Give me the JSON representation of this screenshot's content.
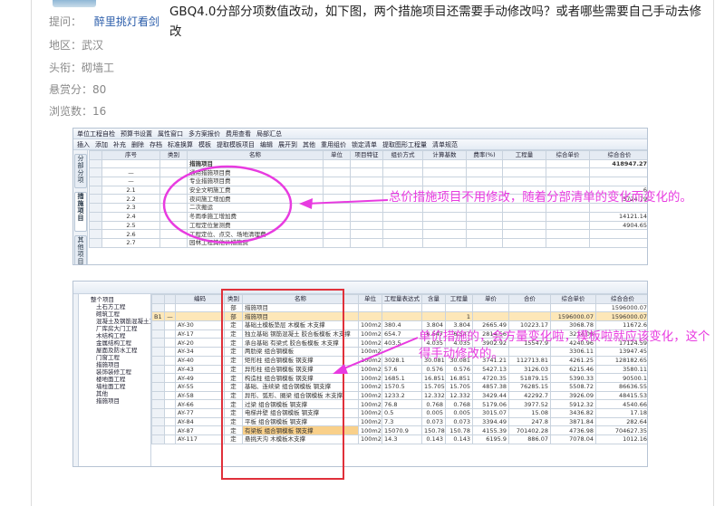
{
  "question": {
    "asker_label": "提问：",
    "asker_name": "醉里挑灯看剑",
    "region_label": "地区：",
    "region_value": "武汉",
    "title_label": "头衔：",
    "title_value": "砌墙工",
    "bounty_label": "悬赏分：",
    "bounty_value": "80",
    "views_label": "浏览数：",
    "views_value": "16",
    "text": "GBQ4.0分部分项数值改动，如下图，两个措施项目还需要手动修改吗？或者哪些需要自己手动去修改"
  },
  "shot1": {
    "toolbar1": [
      "单位工程自检",
      "预算书设置",
      "属性窗口",
      "多方案报价",
      "费用查看",
      "局部汇总"
    ],
    "toolbar2": [
      "插入",
      "添加",
      "补充",
      "删除",
      "存档",
      "标准换算",
      "模板",
      "提取模板项目",
      "编辑",
      "展开到",
      "其他",
      "重用组价",
      "锁定清单",
      "提取图形工程量",
      "清单规范"
    ],
    "side_tabs": [
      "分部分项",
      "措施项目",
      "其他项目"
    ],
    "headers": [
      "",
      "序号",
      "类别",
      "名称",
      "单位",
      "项目特征",
      "组价方式",
      "计算基数",
      "费率(%)",
      "工程量",
      "综合单价",
      "综合合价"
    ],
    "rows": [
      {
        "rh": "",
        "seq": "",
        "cat": "",
        "name": "措施项目",
        "total": "418947.27"
      },
      {
        "rh": "",
        "seq": "—",
        "cat": "",
        "name": "通用措施项目费",
        "total": ""
      },
      {
        "rh": "",
        "seq": "—",
        "cat": "",
        "name": "专业措施项目费",
        "total": ""
      },
      {
        "rh": "",
        "seq": "2.1",
        "cat": "",
        "name": "安全文明施工费",
        "total": "6"
      },
      {
        "rh": "",
        "seq": "2.2",
        "cat": "",
        "name": "夜间施工增加费",
        "total": "5724.79"
      },
      {
        "rh": "",
        "seq": "2.3",
        "cat": "",
        "name": "二次搬运",
        "total": ""
      },
      {
        "rh": "",
        "seq": "2.4",
        "cat": "",
        "name": "冬雨季施工增加费",
        "total": "14121.14"
      },
      {
        "rh": "",
        "seq": "2.5",
        "cat": "",
        "name": "工程定位复测费",
        "total": "4904.65"
      },
      {
        "rh": "",
        "seq": "2.6",
        "cat": "",
        "name": "工程定位、点交、场地清理费",
        "total": ""
      },
      {
        "rh": "",
        "seq": "2.7",
        "cat": "",
        "name": "园林工程其他价措施费",
        "total": ""
      }
    ]
  },
  "shot2": {
    "tree": [
      "整个项目",
      "土石方工程",
      "砌筑工程",
      "混凝土及钢筋混凝土工程",
      "厂库房大门工程",
      "木结构工程",
      "金属结构工程",
      "屋面及防水工程",
      "门窗工程",
      "措施项目",
      "装饰装修工程",
      "楼地面工程",
      "墙柱面工程",
      "其他",
      "措施项目"
    ],
    "headers": [
      "",
      "",
      "编码",
      "类别",
      "名称",
      "单位",
      "工程量表达式",
      "含量",
      "工程量",
      "单价",
      "合价",
      "综合单价",
      "综合合价"
    ],
    "rows": [
      {
        "a": "",
        "b": "",
        "code": "",
        "cat": "部",
        "name": "措施项目",
        "unit": "",
        "expr": "",
        "qty": "",
        "amt": "",
        "price": "",
        "sum": "",
        "uprice": "",
        "total": "1596000.07",
        "hl": false
      },
      {
        "a": "B1",
        "b": "—",
        "code": "",
        "cat": "部",
        "name": "措施项目",
        "unit": "",
        "expr": "",
        "qty": "",
        "amt": "1",
        "price": "",
        "sum": "",
        "uprice": "1596000.07",
        "total": "1596000.07",
        "hl": true
      },
      {
        "a": "",
        "b": "",
        "code": "AY-30",
        "cat": "定",
        "name": "基础土模板垫层 木模板 木支撑",
        "unit": "100m2",
        "expr": "380.4",
        "qty": "3.804",
        "amt": "3.804",
        "price": "2665.49",
        "sum": "10223.17",
        "uprice": "3068.78",
        "total": "11672.6",
        "hl": false
      },
      {
        "a": "",
        "b": "",
        "code": "AY-17",
        "cat": "定",
        "name": "独立基础 钢筋混凝土 胶合板模板 木支撑",
        "unit": "100m2",
        "expr": "654.7",
        "qty": "6.547",
        "amt": "6.547",
        "price": "2814.56",
        "sum": "",
        "uprice": "3214.06",
        "total": "",
        "hl": false
      },
      {
        "a": "",
        "b": "",
        "code": "AY-20",
        "cat": "定",
        "name": "承台基础 有梁式 胶合板模板 木支撑",
        "unit": "100m2",
        "expr": "403.5",
        "qty": "4.035",
        "amt": "4.035",
        "price": "3902.92",
        "sum": "15547.9",
        "uprice": "4240.96",
        "total": "17124.59",
        "hl": false
      },
      {
        "a": "",
        "b": "",
        "code": "AY-34",
        "cat": "定",
        "name": "两肋梁 组合钢模板",
        "unit": "100m2",
        "expr": "",
        "qty": "",
        "amt": "",
        "price": "",
        "sum": "",
        "uprice": "3306.11",
        "total": "13947.45",
        "hl": false
      },
      {
        "a": "",
        "b": "",
        "code": "AY-40",
        "cat": "定",
        "name": "矩形柱 组合钢模板 钢支撑",
        "unit": "100m2",
        "expr": "3028.1",
        "qty": "30.081",
        "amt": "30.081",
        "price": "3741.21",
        "sum": "112713.81",
        "uprice": "4261.25",
        "total": "128182.65",
        "hl": false
      },
      {
        "a": "",
        "b": "",
        "code": "AY-43",
        "cat": "定",
        "name": "异形柱 组合钢模板 钢支撑",
        "unit": "100m2",
        "expr": "57.6",
        "qty": "0.576",
        "amt": "0.576",
        "price": "5427.13",
        "sum": "3126.03",
        "uprice": "6215.46",
        "total": "3580.11",
        "hl": false
      },
      {
        "a": "",
        "b": "",
        "code": "AY-49",
        "cat": "定",
        "name": "构造柱 组合钢模板 钢支撑",
        "unit": "100m2",
        "expr": "1685.1",
        "qty": "16.851",
        "amt": "16.851",
        "price": "4720.35",
        "sum": "51879.15",
        "uprice": "5390.33",
        "total": "90500.1",
        "hl": false
      },
      {
        "a": "",
        "b": "",
        "code": "AY-55",
        "cat": "定",
        "name": "基础、连续梁 组合钢模板 钢支撑",
        "unit": "100m2",
        "expr": "1570.5",
        "qty": "15.705",
        "amt": "15.705",
        "price": "4857.38",
        "sum": "76285.15",
        "uprice": "5508.72",
        "total": "86636.55",
        "hl": false
      },
      {
        "a": "",
        "b": "",
        "code": "AY-58",
        "cat": "定",
        "name": "异形、弧形、圈梁 组合钢模板 木支撑",
        "unit": "100m2",
        "expr": "1233.2",
        "qty": "12.332",
        "amt": "12.332",
        "price": "3429.44",
        "sum": "42292.7",
        "uprice": "3926.09",
        "total": "48415.53",
        "hl": false
      },
      {
        "a": "",
        "b": "",
        "code": "AY-66",
        "cat": "定",
        "name": "过梁 组合钢模板 钢支撑",
        "unit": "100m2",
        "expr": "76.8",
        "qty": "0.768",
        "amt": "0.768",
        "price": "5179.06",
        "sum": "3977.52",
        "uprice": "5912.32",
        "total": "4540.66",
        "hl": false
      },
      {
        "a": "",
        "b": "",
        "code": "AY-77",
        "cat": "定",
        "name": "电梯井壁 组合钢模板 钢支撑",
        "unit": "100m2",
        "expr": "0.5",
        "qty": "0.005",
        "amt": "0.005",
        "price": "3015.07",
        "sum": "15.08",
        "uprice": "3436.82",
        "total": "17.18",
        "hl": false
      },
      {
        "a": "",
        "b": "",
        "code": "AY-84",
        "cat": "定",
        "name": "平板 组合钢模板 钢支撑",
        "unit": "100m2",
        "expr": "7.3",
        "qty": "0.073",
        "amt": "0.073",
        "price": "3394.49",
        "sum": "247.8",
        "uprice": "3871.84",
        "total": "282.64",
        "hl": false
      },
      {
        "a": "",
        "b": "",
        "code": "AY-87",
        "cat": "定",
        "name": "有梁板 组合钢模板 钢支撑",
        "unit": "100m2",
        "expr": "15070.9",
        "qty": "150.78",
        "amt": "150.78",
        "price": "4155.39",
        "sum": "701402.28",
        "uprice": "4736.98",
        "total": "704627.35",
        "hl": false,
        "sel": true
      },
      {
        "a": "",
        "b": "",
        "code": "AY-117",
        "cat": "定",
        "name": "悬挑天沟 木模板木支撑",
        "unit": "100m2",
        "expr": "14.3",
        "qty": "0.143",
        "amt": "0.143",
        "price": "6195.9",
        "sum": "886.07",
        "uprice": "7078.04",
        "total": "1012.16",
        "hl": false
      }
    ]
  },
  "annotations": {
    "a1": "总价措施项目不用修改，随着分部清单的变化而变化的。",
    "a2": "单价措施的，会方量变化啦，模板啦就应该变化，这个得手动修改的。",
    "highlight_color": "#e83be0",
    "box_color": "#e0303a"
  }
}
